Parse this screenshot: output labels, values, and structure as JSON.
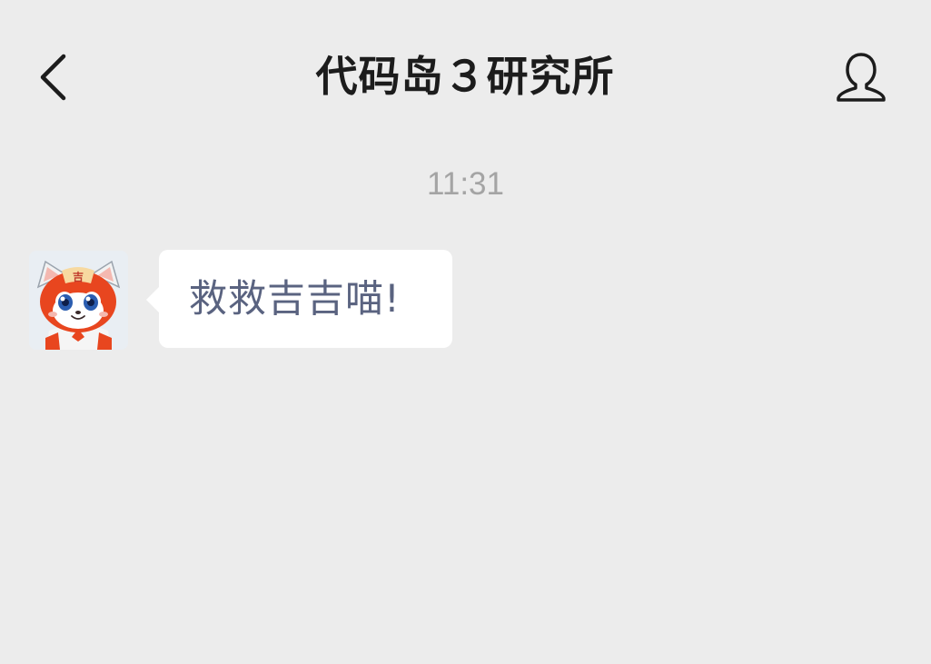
{
  "header": {
    "title": "代码岛３研究所",
    "back_icon": "chevron-left-icon",
    "profile_icon": "person-icon"
  },
  "chat": {
    "timestamp": "11:31",
    "messages": [
      {
        "avatar_icon": "cat-mascot-avatar",
        "text": "救救吉吉喵!"
      }
    ]
  },
  "colors": {
    "background": "#ececec",
    "bubble": "#ffffff",
    "message_text": "#5a6380",
    "timestamp": "#a4a4a4",
    "title": "#1c1c1c",
    "mascot_orange": "#e8461f",
    "mascot_blue": "#2a5db0"
  }
}
